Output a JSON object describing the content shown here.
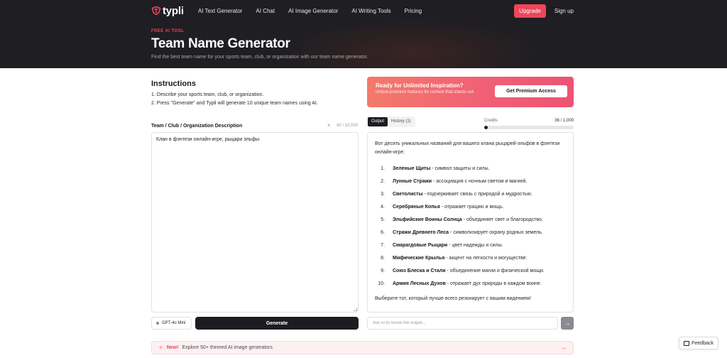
{
  "brand": {
    "name": "typli",
    "accent": "#ef4559"
  },
  "nav": {
    "links": [
      "AI Text Generator",
      "AI Chat",
      "AI Image Generator",
      "AI Writing Tools",
      "Pricing"
    ],
    "upgrade": "Upgrade",
    "signup": "Sign up"
  },
  "hero": {
    "eyebrow": "FREE AI TOOL",
    "title": "Team Name Generator",
    "subtitle": "Find the best team name for your sports team, club, or organization with our team name generator."
  },
  "instructions": {
    "title": "Instructions",
    "steps": [
      "1. Describe your sports team, club, or organization.",
      "2. Press \"Generate\" and Typli will generate 10 unique team names using AI."
    ]
  },
  "input": {
    "label": "Team / Club / Organization Description",
    "clear": "×",
    "counter": "40 / 10,000",
    "value": "Клан в фэнтези онлайн-игре, рыцари эльфы"
  },
  "model": {
    "label": "GPT-4o Mini"
  },
  "generate_label": "Generate",
  "promo": {
    "title": "Ready for Unlimited Inspiration?",
    "subtitle": "Unlock premium features for content that stands out.",
    "button": "Get Premium Access"
  },
  "output_tabs": [
    "Output",
    "History (1)"
  ],
  "credits": {
    "label": "Credits",
    "value": "36 / 1,000",
    "fraction": 0.036
  },
  "output": {
    "intro": "Вот десять уникальных названий для вашего клана рыцарей-эльфов в фэнтези онлайн-игре:",
    "items": [
      {
        "num": "1.",
        "name": "Зеленые Щиты",
        "desc": " - символ защиты и силы."
      },
      {
        "num": "2.",
        "name": "Лунные Стражи",
        "desc": " - ассоциация с ночным светом и магией."
      },
      {
        "num": "3.",
        "name": "Светолисты",
        "desc": " - подчеркивает связь с природой и мудростью."
      },
      {
        "num": "4.",
        "name": "Серебряные Копья",
        "desc": " - отражает грацию и мощь."
      },
      {
        "num": "5.",
        "name": "Эльфийские Воины Солнца",
        "desc": " - объединяет свет и благородство."
      },
      {
        "num": "6.",
        "name": "Стражи Древнего Леса",
        "desc": " - символизирует охрану родных земель."
      },
      {
        "num": "7.",
        "name": "Смарагдовые Рыцари",
        "desc": " - цвет надежды и силы."
      },
      {
        "num": "8.",
        "name": "Мифические Крылья",
        "desc": " - акцент на легкости и могуществе."
      },
      {
        "num": "9.",
        "name": "Союз Блеска и Стали",
        "desc": " - объединение магии и физической мощи."
      },
      {
        "num": "10.",
        "name": "Армия Лесных Духов",
        "desc": " - отражает дух природы в каждом воине."
      }
    ],
    "outro": "Выберите тот, который лучше всего резонирует с вашим видением!"
  },
  "revise": {
    "placeholder": "Ask AI to revise the output...",
    "send_icon": "arrow-right-icon"
  },
  "banner": {
    "new": "New!",
    "text": "Explore 50+ themed AI image generators",
    "arrow": "→"
  },
  "feedback": {
    "label": "Feedback"
  }
}
